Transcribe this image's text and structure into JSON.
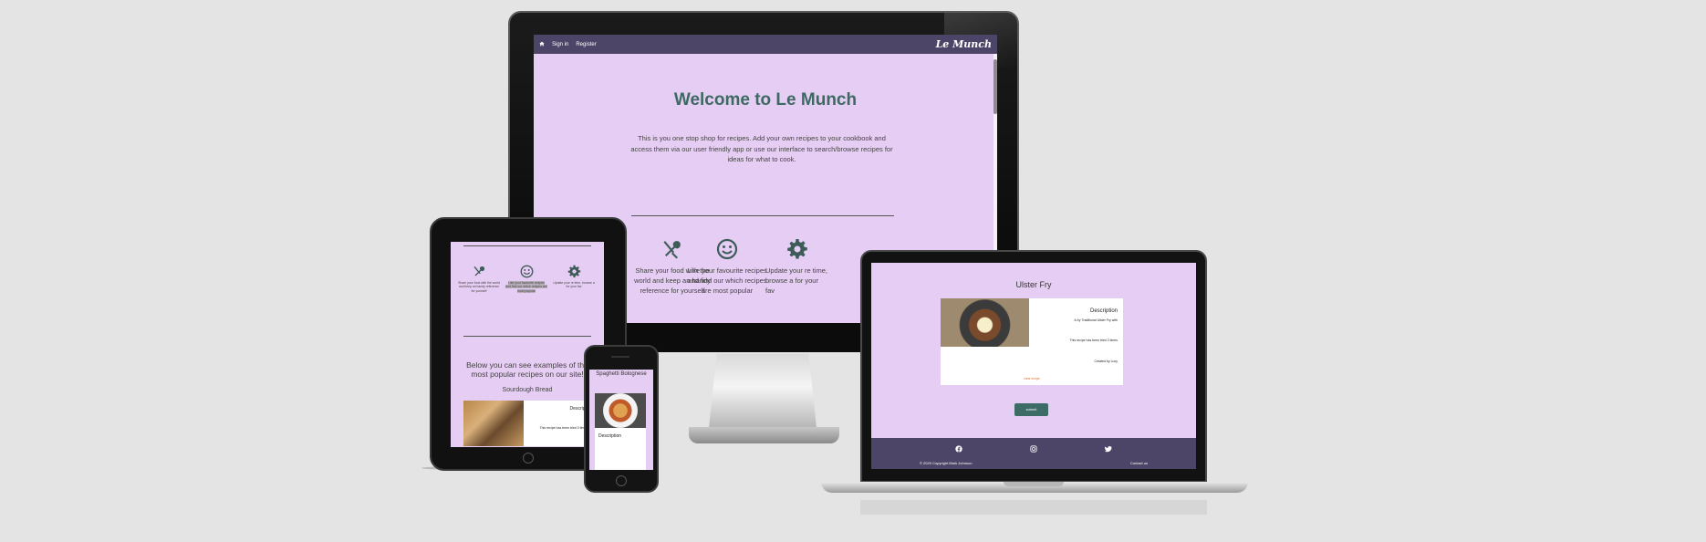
{
  "desktop": {
    "nav": {
      "home_icon": "home-icon",
      "sign_in": "Sign in",
      "register": "Register",
      "brand": "Le Munch"
    },
    "title": "Welcome to Le Munch",
    "intro": "This is you one stop shop for recipes. Add your own recipes to your cookbook and access them via our user friendly app or use our interface to search/browse recipes for ideas for what to cook.",
    "features": [
      {
        "icon": "utensils-icon",
        "text": "Share your food with the world and keep an handy reference for yourself"
      },
      {
        "icon": "smile-icon",
        "text": "Like your favourite recipes and find our which recipes are most popular"
      },
      {
        "icon": "gear-icon",
        "text": "Update your re time, browse a for your fav"
      }
    ]
  },
  "tablet": {
    "heading": "Below you can see examples of the most popular recipes on our site!",
    "recipe_name": "Sourdough Bread",
    "card": {
      "description": "Descripti",
      "made": "This recipe has been tried 0 times"
    }
  },
  "laptop": {
    "title": "Ulster Fry",
    "card": {
      "description": "Description",
      "summary": "A fry Traditional Ulster Fry with",
      "made": "This recipe has been tried 2 times",
      "created": "Created by Lucy",
      "link": "view recipe"
    },
    "button": "submit",
    "footer": {
      "copyright": "© 2020 Copyright Mark Johnson",
      "contact": "Contact us"
    }
  },
  "phone": {
    "title": "Spaghetti Bolognese",
    "card": {
      "description": "Description"
    }
  },
  "colors": {
    "background": "#e6cdf3",
    "nav": "#4d4567",
    "accent": "#3c6a62"
  }
}
